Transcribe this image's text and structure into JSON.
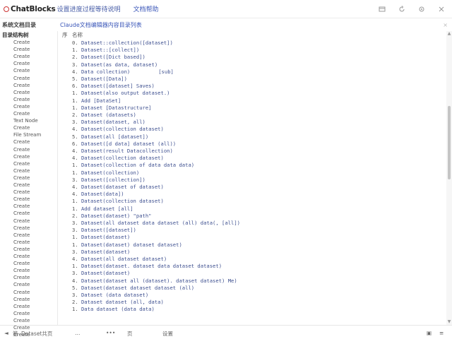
{
  "header": {
    "logo_text": "ChatBlocks",
    "title": "设置进度过程等待说明",
    "link": "文档帮助",
    "icons": [
      "settings-icon",
      "refresh-icon",
      "gear-icon",
      "close-icon"
    ]
  },
  "subheader": {
    "left_label": "系统文档目录",
    "right_label": "Claude文档编辑器内容目录列表",
    "close_glyph": "×"
  },
  "sidebar": {
    "header": "目录结构树",
    "items": [
      "Create",
      "Create",
      "Create",
      "Create",
      "Create",
      "Create",
      "Create",
      "Create",
      "Create",
      "Create",
      "Create",
      "Text Node",
      "Create",
      "File Stream",
      "Create",
      "Create",
      "Create",
      "Create",
      "Create",
      "Create",
      "Create",
      "Create",
      "Create",
      "Create",
      "Create",
      "Create",
      "Create",
      "Create",
      "Create",
      "Create",
      "Create",
      "Create",
      "Create",
      "Create",
      "Create",
      "Create",
      "Create",
      "Create",
      "Create",
      "Create",
      "Create",
      "Create"
    ]
  },
  "main": {
    "header_col1": "序",
    "header_col2": "名称",
    "lines": [
      {
        "num": "0.",
        "text": "Dataset::collection([dataset])"
      },
      {
        "num": "1.",
        "text": "Dataset::[collect])"
      },
      {
        "num": "2.",
        "text": "Dataset([Dict based])"
      },
      {
        "num": "3.",
        "text": "Dataset(as data, dataset)"
      },
      {
        "num": "4.",
        "text": "Data collection)",
        "tag": "[sub]"
      },
      {
        "num": "5.",
        "text": "Dataset([Data])"
      },
      {
        "num": "6.",
        "text": "Dataset([dataset] Saves)"
      },
      {
        "num": "1.",
        "text": "Dataset(also output dataset.)"
      },
      {
        "num": "1.",
        "text": "Add [DataSet]"
      },
      {
        "num": "1.",
        "text": "Dataset [Datastructure]"
      },
      {
        "num": "2.",
        "text": "Dataset (datasets)"
      },
      {
        "num": "3.",
        "text": "Dataset(dataset, all)"
      },
      {
        "num": "4.",
        "text": "Dataset(collection dataset)"
      },
      {
        "num": "5.",
        "text": "Dataset(all [dataset])"
      },
      {
        "num": "6.",
        "text": "Dataset([d data] dataset (all))"
      },
      {
        "num": "4.",
        "text": "Dataset(result Datacollection)"
      },
      {
        "num": "4.",
        "text": "Dataset(collection dataset)"
      },
      {
        "num": "1.",
        "text": "Dataset(collection of data data data)"
      },
      {
        "num": "1.",
        "text": "Dataset(collection)"
      },
      {
        "num": "3.",
        "text": "Dataset([collection])"
      },
      {
        "num": "4.",
        "text": "Dataset(dataset of dataset)"
      },
      {
        "num": "4.",
        "text": "Dataset(data])"
      },
      {
        "num": "1.",
        "text": "Dataset(collection dataset)"
      },
      {
        "num": "1.",
        "text": "Add dataset [all]"
      },
      {
        "num": "2.",
        "text": "Dataset(dataset) \"path\""
      },
      {
        "num": "3.",
        "text": "Dataset(all dataset data dataset (all) data(, [all])"
      },
      {
        "num": "3.",
        "text": "Dataset([dataset])"
      },
      {
        "num": "1.",
        "text": "Dataset(dataset)"
      },
      {
        "num": "1.",
        "text": "Dataset(dataset) dataset dataset)"
      },
      {
        "num": "3.",
        "text": "Dataset(dataset)"
      },
      {
        "num": "4.",
        "text": "Dataset(all dataset dataset)"
      },
      {
        "num": "1.",
        "text": "Dataset(dataset. dataset data dataset dataset)"
      },
      {
        "num": "3.",
        "text": "Dataset(dataset)"
      },
      {
        "num": "4.",
        "text": "Dataset(dataset all (dataset). dataset dataset) Me)"
      },
      {
        "num": "5.",
        "text": "Dataset(dataset dataset dataset (all)"
      },
      {
        "num": "3.",
        "text": "Dataset (data dataset)"
      },
      {
        "num": "2.",
        "text": "Dataset dataset (all, data)"
      },
      {
        "num": "1.",
        "text": "Data dataset (data data)"
      }
    ]
  },
  "footer": {
    "item1": "◄",
    "item2": "第",
    "item3": "Dataset共页",
    "item4": "…",
    "item5": "•••",
    "item6": "页",
    "item7": "设置",
    "icon_a": "▣",
    "icon_b": "≡"
  }
}
